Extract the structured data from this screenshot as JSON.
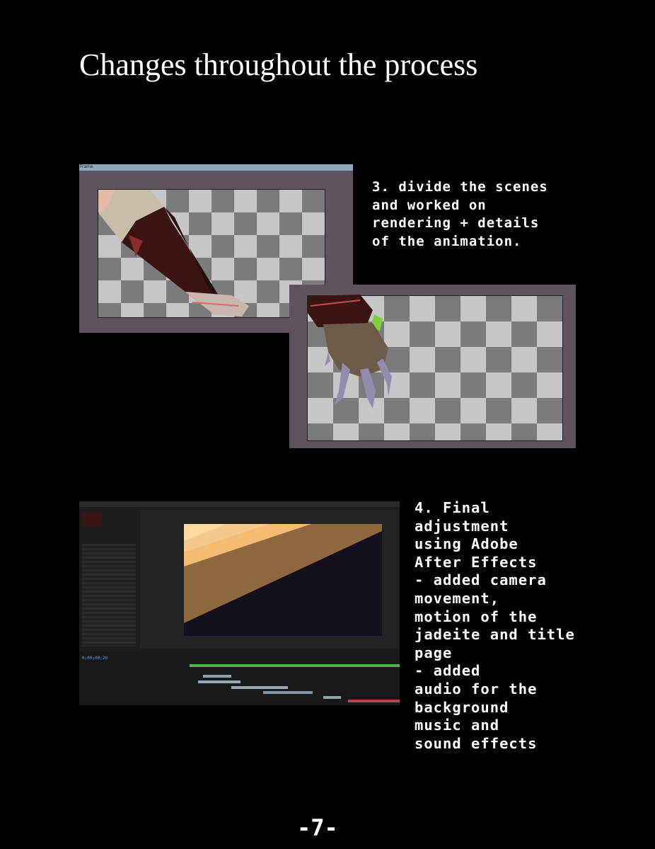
{
  "title": "Changes throughout the process",
  "step3": {
    "caption_lines": [
      "3. divide the scenes",
      "and worked on",
      "rendering + details",
      "of the animation."
    ],
    "window_label": "Frame"
  },
  "step4": {
    "caption_lines": [
      "4. Final",
      "adjustment",
      "using Adobe",
      "After Effects",
      "- added camera",
      "movement,",
      "motion of the",
      "jadeite and title",
      "page",
      "- added",
      "audio for the",
      "background",
      "music and",
      "sound effects"
    ],
    "timecode": "0;00;00;29"
  },
  "page_number": "-7-",
  "colors": {
    "frame": "#5e535c",
    "checker_dark": "#7b7b7b",
    "checker_light": "#c6c6c6",
    "accent_orange": "#f2b15c"
  }
}
